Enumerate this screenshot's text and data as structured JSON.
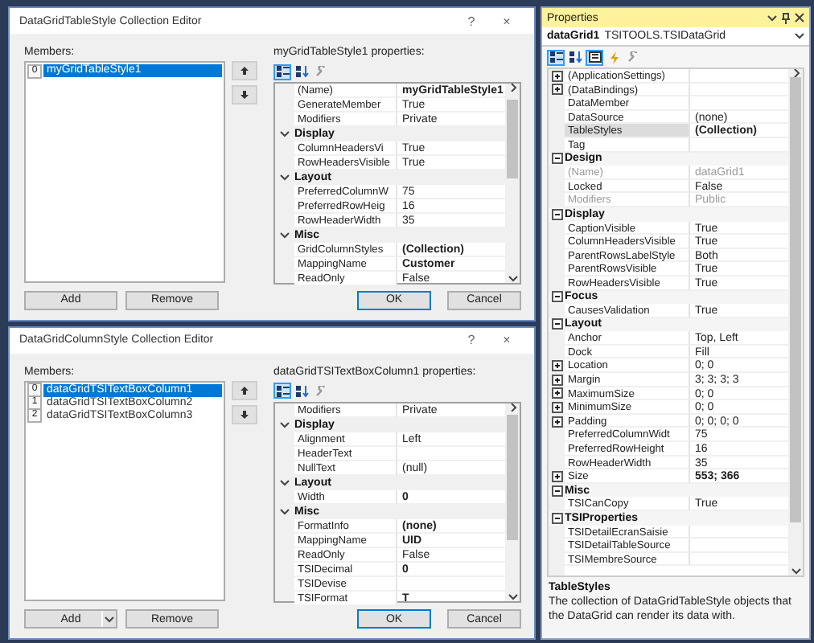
{
  "dialogs": [
    {
      "title": "DataGridTableStyle Collection Editor",
      "title_buttons": [
        "?",
        "×"
      ],
      "members_label": "Members:",
      "members": [
        {
          "index": "0",
          "name": "myGridTableStyle1",
          "selected": true
        }
      ],
      "add": "Add",
      "add_dropdown": false,
      "remove": "Remove",
      "properties_label": "myGridTableStyle1 properties:",
      "toolbar": [
        {
          "kind": "categorized",
          "selected": true
        },
        {
          "kind": "alphabetical",
          "selected": false
        },
        {
          "kind": "property_pages",
          "selected": false
        }
      ],
      "properties": [
        {
          "kind": "property",
          "name": "(Name)",
          "value": "myGridTableStyle1",
          "bold": true
        },
        {
          "kind": "property",
          "name": "GenerateMember",
          "value": "True",
          "bold": false
        },
        {
          "kind": "property",
          "name": "Modifiers",
          "value": "Private",
          "bold": false
        },
        {
          "kind": "category",
          "name": "Display",
          "expanded": true
        },
        {
          "kind": "property",
          "name": "ColumnHeadersVi",
          "value": "True",
          "bold": false
        },
        {
          "kind": "property",
          "name": "RowHeadersVisible",
          "value": "True",
          "bold": false
        },
        {
          "kind": "category",
          "name": "Layout",
          "expanded": true
        },
        {
          "kind": "property",
          "name": "PreferredColumnW",
          "value": "75",
          "bold": false
        },
        {
          "kind": "property",
          "name": "PreferredRowHeig",
          "value": "16",
          "bold": false
        },
        {
          "kind": "property",
          "name": "RowHeaderWidth",
          "value": "35",
          "bold": false
        },
        {
          "kind": "category",
          "name": "Misc",
          "expanded": true
        },
        {
          "kind": "property",
          "name": "GridColumnStyles",
          "value": "(Collection)",
          "bold": true
        },
        {
          "kind": "property",
          "name": "MappingName",
          "value": "Customer",
          "bold": true
        },
        {
          "kind": "property",
          "name": "ReadOnly",
          "value": "False",
          "bold": false
        }
      ],
      "ok": "OK",
      "cancel": "Cancel"
    },
    {
      "title": "DataGridColumnStyle Collection Editor",
      "title_buttons": [
        "?",
        "×"
      ],
      "members_label": "Members:",
      "members": [
        {
          "index": "0",
          "name": "dataGridTSITextBoxColumn1",
          "selected": true
        },
        {
          "index": "1",
          "name": "dataGridTSITextBoxColumn2",
          "selected": false
        },
        {
          "index": "2",
          "name": "dataGridTSITextBoxColumn3",
          "selected": false
        }
      ],
      "add": "Add",
      "add_dropdown": true,
      "remove": "Remove",
      "properties_label": "dataGridTSITextBoxColumn1 properties:",
      "toolbar": [
        {
          "kind": "categorized",
          "selected": true
        },
        {
          "kind": "alphabetical",
          "selected": false
        },
        {
          "kind": "property_pages",
          "selected": false
        }
      ],
      "properties": [
        {
          "kind": "property",
          "name": "Modifiers",
          "value": "Private",
          "bold": false
        },
        {
          "kind": "category",
          "name": "Display",
          "expanded": true
        },
        {
          "kind": "property",
          "name": "Alignment",
          "value": "Left",
          "bold": false
        },
        {
          "kind": "property",
          "name": "HeaderText"
        },
        {
          "kind": "property",
          "name": "NullText",
          "value": "(null)",
          "bold": false
        },
        {
          "kind": "category",
          "name": "Layout",
          "expanded": true
        },
        {
          "kind": "property",
          "name": "Width",
          "value": "0",
          "bold": true
        },
        {
          "kind": "category",
          "name": "Misc",
          "expanded": true
        },
        {
          "kind": "property",
          "name": "FormatInfo",
          "value": "(none)",
          "bold": true
        },
        {
          "kind": "property",
          "name": "MappingName",
          "value": "UID",
          "bold": true
        },
        {
          "kind": "property",
          "name": "ReadOnly",
          "value": "False",
          "bold": false
        },
        {
          "kind": "property",
          "name": "TSIDecimal",
          "value": "0",
          "bold": true
        },
        {
          "kind": "property",
          "name": "TSIDevise"
        },
        {
          "kind": "property",
          "name": "TSIFormat",
          "value": "T",
          "bold": true
        }
      ],
      "ok": "OK",
      "cancel": "Cancel"
    }
  ],
  "properties_panel": {
    "title": "Properties",
    "object_name": "dataGrid1",
    "object_type": "TSITOOLS.TSIDataGrid",
    "toolbar": [
      {
        "kind": "categorized",
        "selected": true
      },
      {
        "kind": "alphabetical",
        "selected": false
      },
      {
        "kind": "properties",
        "selected": true
      },
      {
        "kind": "events",
        "selected": false
      },
      {
        "kind": "property_pages",
        "selected": false
      }
    ],
    "rows": [
      {
        "kind": "expandable",
        "name": "(ApplicationSettings)",
        "disabled": false,
        "selected": false
      },
      {
        "kind": "expandable",
        "name": "(DataBindings)",
        "disabled": false,
        "selected": false
      },
      {
        "kind": "property",
        "name": "DataMember",
        "disabled": false,
        "selected": false
      },
      {
        "kind": "property",
        "name": "DataSource",
        "value": "(none)",
        "bold": false,
        "disabled": false,
        "selected": false
      },
      {
        "kind": "property",
        "name": "TableStyles",
        "value": "(Collection)",
        "bold": true,
        "disabled": false,
        "selected": true
      },
      {
        "kind": "property",
        "name": "Tag",
        "disabled": false,
        "selected": false
      },
      {
        "kind": "category",
        "name": "Design",
        "expanded": true
      },
      {
        "kind": "property",
        "name": "(Name)",
        "value": "dataGrid1",
        "bold": false,
        "disabled": true,
        "selected": false
      },
      {
        "kind": "property",
        "name": "Locked",
        "value": "False",
        "bold": false,
        "disabled": false,
        "selected": false
      },
      {
        "kind": "property",
        "name": "Modifiers",
        "value": "Public",
        "bold": false,
        "disabled": true,
        "selected": false
      },
      {
        "kind": "category",
        "name": "Display",
        "expanded": true
      },
      {
        "kind": "property",
        "name": "CaptionVisible",
        "value": "True",
        "bold": false,
        "disabled": false,
        "selected": false
      },
      {
        "kind": "property",
        "name": "ColumnHeadersVisible",
        "value": "True",
        "bold": false,
        "disabled": false,
        "selected": false
      },
      {
        "kind": "property",
        "name": "ParentRowsLabelStyle",
        "value": "Both",
        "bold": false,
        "disabled": false,
        "selected": false
      },
      {
        "kind": "property",
        "name": "ParentRowsVisible",
        "value": "True",
        "bold": false,
        "disabled": false,
        "selected": false
      },
      {
        "kind": "property",
        "name": "RowHeadersVisible",
        "value": "True",
        "bold": false,
        "disabled": false,
        "selected": false
      },
      {
        "kind": "category",
        "name": "Focus",
        "expanded": true
      },
      {
        "kind": "property",
        "name": "CausesValidation",
        "value": "True",
        "bold": false,
        "disabled": false,
        "selected": false
      },
      {
        "kind": "category",
        "name": "Layout",
        "expanded": true
      },
      {
        "kind": "property",
        "name": "Anchor",
        "value": "Top, Left",
        "bold": false,
        "disabled": false,
        "selected": false
      },
      {
        "kind": "property",
        "name": "Dock",
        "value": "Fill",
        "bold": false,
        "disabled": false,
        "selected": false
      },
      {
        "kind": "expandable",
        "name": "Location",
        "value": "0; 0",
        "bold": false,
        "disabled": false,
        "selected": false
      },
      {
        "kind": "expandable",
        "name": "Margin",
        "value": "3; 3; 3; 3",
        "bold": false,
        "disabled": false,
        "selected": false
      },
      {
        "kind": "expandable",
        "name": "MaximumSize",
        "value": "0; 0",
        "bold": false,
        "disabled": false,
        "selected": false
      },
      {
        "kind": "expandable",
        "name": "MinimumSize",
        "value": "0; 0",
        "bold": false,
        "disabled": false,
        "selected": false
      },
      {
        "kind": "expandable",
        "name": "Padding",
        "value": "0; 0; 0; 0",
        "bold": false,
        "disabled": false,
        "selected": false
      },
      {
        "kind": "property",
        "name": "PreferredColumnWidt",
        "value": "75",
        "bold": false,
        "disabled": false,
        "selected": false
      },
      {
        "kind": "property",
        "name": "PreferredRowHeight",
        "value": "16",
        "bold": false,
        "disabled": false,
        "selected": false
      },
      {
        "kind": "property",
        "name": "RowHeaderWidth",
        "value": "35",
        "bold": false,
        "disabled": false,
        "selected": false
      },
      {
        "kind": "expandable",
        "name": "Size",
        "value": "553; 366",
        "bold": true,
        "disabled": false,
        "selected": false
      },
      {
        "kind": "category",
        "name": "Misc",
        "expanded": true
      },
      {
        "kind": "property",
        "name": "TSICanCopy",
        "value": "True",
        "bold": false,
        "disabled": false,
        "selected": false
      },
      {
        "kind": "category",
        "name": "TSIProperties",
        "expanded": true
      },
      {
        "kind": "property",
        "name": "TSIDetailEcranSaisie",
        "disabled": false,
        "selected": false
      },
      {
        "kind": "property",
        "name": "TSIDetailTableSource",
        "disabled": false,
        "selected": false
      },
      {
        "kind": "property",
        "name": "TSIMembreSource",
        "disabled": false,
        "selected": false
      }
    ],
    "description_title": "TableStyles",
    "description": "The collection of DataGridTableStyle objects that the DataGrid can render its data with."
  }
}
